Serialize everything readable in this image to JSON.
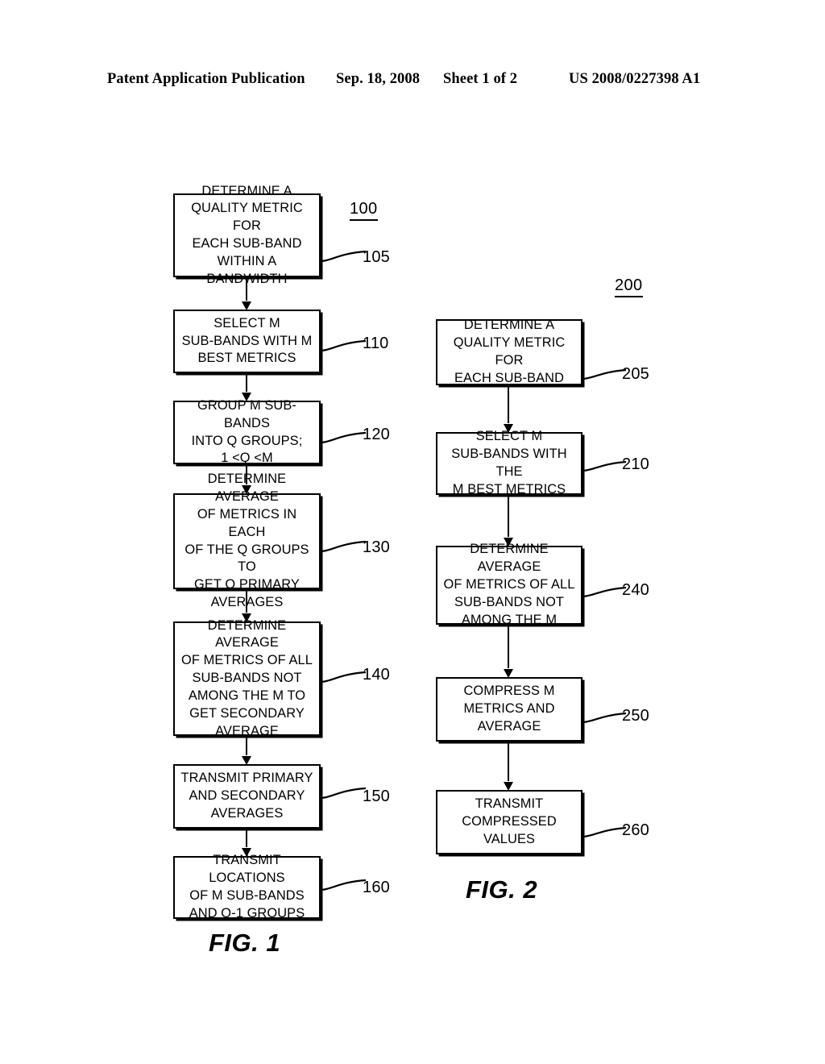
{
  "header": {
    "publication": "Patent Application Publication",
    "date": "Sep. 18, 2008",
    "sheet": "Sheet 1 of 2",
    "patent_number": "US 2008/0227398 A1"
  },
  "figures": [
    {
      "id": "fig1",
      "caption": "FIG. 1",
      "title_ref": "100",
      "steps": [
        {
          "ref": "105",
          "text": "DETERMINE A\nQUALITY METRIC FOR\nEACH SUB-BAND\nWITHIN A BANDWIDTH"
        },
        {
          "ref": "110",
          "text": "SELECT M\nSUB-BANDS WITH M\nBEST METRICS"
        },
        {
          "ref": "120",
          "text": "GROUP M SUB-BANDS\nINTO Q GROUPS;\n1 <Q <M"
        },
        {
          "ref": "130",
          "text": "DETERMINE AVERAGE\nOF METRICS IN EACH\nOF THE Q GROUPS TO\nGET Q PRIMARY\nAVERAGES"
        },
        {
          "ref": "140",
          "text": "DETERMINE AVERAGE\nOF METRICS OF ALL\nSUB-BANDS NOT\nAMONG THE M TO\nGET SECONDARY\nAVERAGE"
        },
        {
          "ref": "150",
          "text": "TRANSMIT PRIMARY\nAND SECONDARY\nAVERAGES"
        },
        {
          "ref": "160",
          "text": "TRANSMIT LOCATIONS\nOF M SUB-BANDS\nAND Q-1 GROUPS"
        }
      ]
    },
    {
      "id": "fig2",
      "caption": "FIG. 2",
      "title_ref": "200",
      "steps": [
        {
          "ref": "205",
          "text": "DETERMINE A\nQUALITY METRIC FOR\nEACH SUB-BAND"
        },
        {
          "ref": "210",
          "text": "SELECT M\nSUB-BANDS WITH THE\nM BEST METRICS"
        },
        {
          "ref": "240",
          "text": "DETERMINE AVERAGE\nOF METRICS OF ALL\nSUB-BANDS NOT\nAMONG THE M"
        },
        {
          "ref": "250",
          "text": "COMPRESS M\nMETRICS AND\nAVERAGE"
        },
        {
          "ref": "260",
          "text": "TRANSMIT\nCOMPRESSED\nVALUES"
        }
      ]
    }
  ],
  "colors": {
    "ink": "#000000",
    "paper": "#ffffff"
  }
}
